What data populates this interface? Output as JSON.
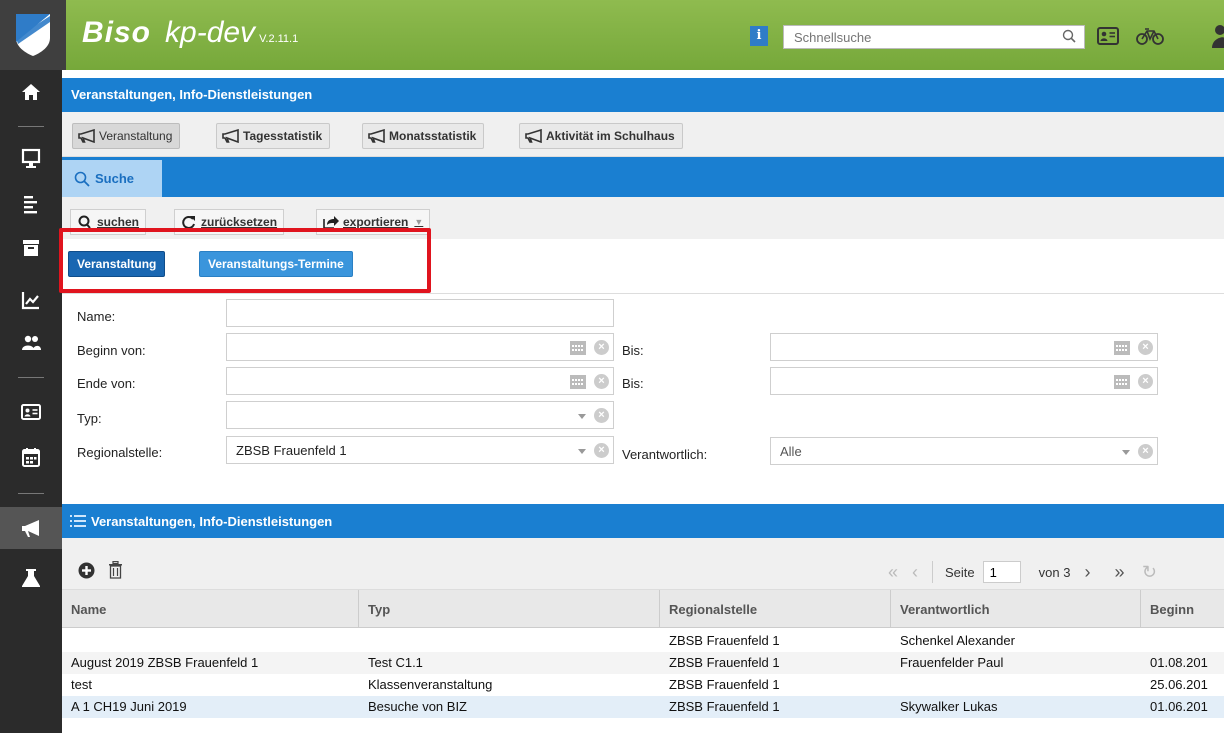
{
  "header": {
    "brand": "Biso",
    "env": "kp-dev",
    "version": "V.2.11.1",
    "info": "i",
    "search_placeholder": "Schnellsuche"
  },
  "sidebar": {
    "items": [
      "home",
      "presentation",
      "list",
      "archive",
      "chart",
      "users",
      "contact-card",
      "calendar",
      "megaphone",
      "flask"
    ],
    "active": "megaphone"
  },
  "page_title": "Veranstaltungen, Info-Dienstleistungen",
  "module_tabs": [
    {
      "label": "Veranstaltung"
    },
    {
      "label": "Tagesstatistik"
    },
    {
      "label": "Monatsstatistik"
    },
    {
      "label": "Aktivität im Schulhaus"
    }
  ],
  "search_tab": "Suche",
  "toolbar": {
    "search": "suchen",
    "reset": "zurücksetzen",
    "export": "exportieren"
  },
  "sub_tabs": {
    "a": "Veranstaltung",
    "b": "Veranstaltungs-Termine"
  },
  "form": {
    "name_label": "Name:",
    "beginn_label": "Beginn von:",
    "bis_label": "Bis:",
    "ende_label": "Ende von:",
    "bis2_label": "Bis:",
    "typ_label": "Typ:",
    "regional_label": "Regionalstelle:",
    "regional_value": "ZBSB Frauenfeld 1",
    "verantwortlich_label": "Verantwortlich:",
    "verantwortlich_value": "Alle"
  },
  "list": {
    "title": "Veranstaltungen, Info-Dienstleistungen",
    "pager": {
      "page_label": "Seite",
      "page": "1",
      "of_label": "von 3"
    },
    "columns": [
      "Name",
      "Typ",
      "Regionalstelle",
      "Verantwortlich",
      "Beginn"
    ],
    "rows": [
      [
        "",
        "",
        "ZBSB Frauenfeld 1",
        "Schenkel Alexander",
        ""
      ],
      [
        "August 2019 ZBSB Frauenfeld 1",
        "Test C1.1",
        "ZBSB Frauenfeld 1",
        "Frauenfelder Paul",
        "01.08.201"
      ],
      [
        "test",
        "Klassenveranstaltung",
        "ZBSB Frauenfeld 1",
        "",
        "25.06.201"
      ],
      [
        "A 1 CH19 Juni 2019",
        "Besuche von BIZ",
        "ZBSB Frauenfeld 1",
        "Skywalker Lukas",
        "01.06.201"
      ]
    ]
  },
  "colors": {
    "header_green": "#80b244",
    "primary_blue": "#1a7fd1",
    "highlight_red": "#e0141e",
    "sidebar": "#2b2b2b"
  }
}
